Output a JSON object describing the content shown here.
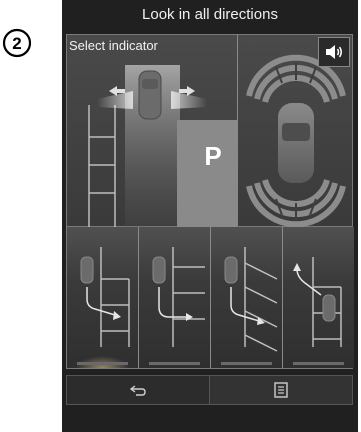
{
  "step_number": "2",
  "header": {
    "title": "Look in all directions"
  },
  "top_panel": {
    "label": "Select indicator",
    "parking_sign": "P"
  },
  "icons": {
    "sound": "speaker-icon",
    "back": "back-arrow-icon",
    "menu": "list-icon"
  },
  "options": [
    {
      "name": "exit-parallel-left",
      "selected": true
    },
    {
      "name": "exit-perpendicular-forward",
      "selected": false
    },
    {
      "name": "exit-angled-forward",
      "selected": false
    },
    {
      "name": "exit-parallel-reverse",
      "selected": false
    }
  ],
  "colors": {
    "background": "#202020",
    "panel": "#3c3c3c",
    "text": "#f0f0f0",
    "accent_glow": "#ffdc96"
  }
}
